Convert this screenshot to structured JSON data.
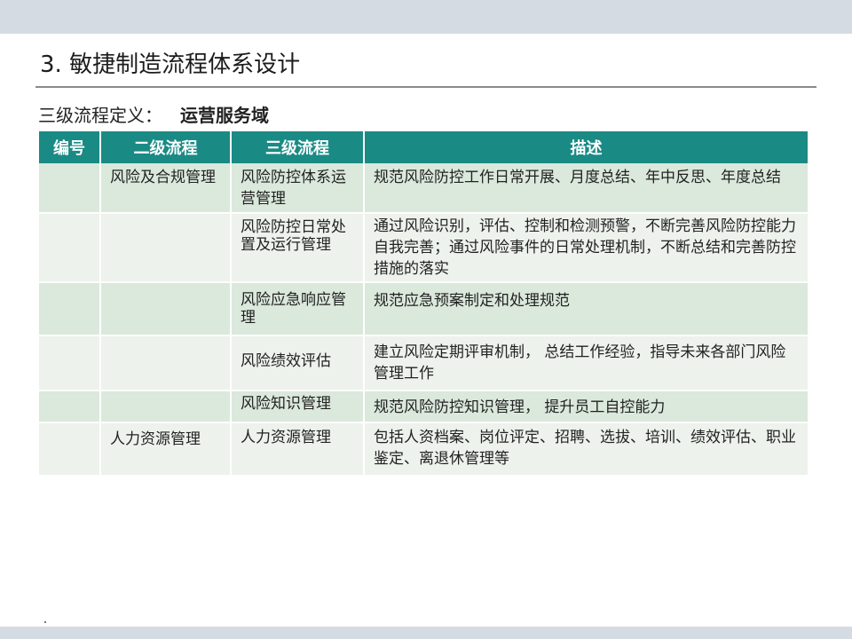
{
  "title": "3. 敏捷制造流程体系设计",
  "subtitle": {
    "label": "三级流程定义：",
    "domain": "运营服务域"
  },
  "table": {
    "headers": [
      "编号",
      "二级流程",
      "三级流程",
      "描述"
    ],
    "rows": [
      {
        "id": "",
        "level2": "风险及合规管理",
        "level3": "风险防控体系运营管理",
        "desc": "规范风险防控工作日常开展、月度总结、年中反思、年度总结"
      },
      {
        "id": "",
        "level2": "",
        "level3": "风险防控日常处置及运行管理",
        "desc": "通过风险识别，评估、控制和检测预警，不断完善风险防控能力自我完善；通过风险事件的日常处理机制，不断总结和完善防控措施的落实"
      },
      {
        "id": "",
        "level2": "",
        "level3": "风险应急响应管理",
        "desc": "规范应急预案制定和处理规范"
      },
      {
        "id": "",
        "level2": "",
        "level3": "风险绩效评估",
        "desc": "建立风险定期评审机制，  总结工作经验，指导未来各部门风险管理工作"
      },
      {
        "id": "",
        "level2": "",
        "level3": "风险知识管理",
        "desc": "规范风险防控知识管理，  提升员工自控能力"
      },
      {
        "id": "",
        "level2": "人力资源管理",
        "level3": "人力资源管理",
        "desc": "包括人资档案、岗位评定、招聘、选拔、培训、绩效评估、职业鉴定、离退休管理等"
      }
    ]
  }
}
